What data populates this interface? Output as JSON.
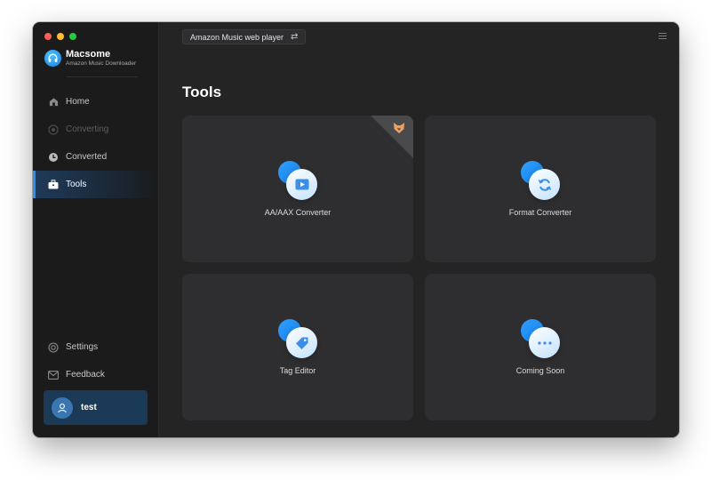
{
  "app": {
    "name": "Macsome",
    "subtitle": "Amazon Music Downloader"
  },
  "sidebar": {
    "items": [
      {
        "label": "Home",
        "icon": "home-icon",
        "state": "normal"
      },
      {
        "label": "Converting",
        "icon": "converting-icon",
        "state": "disabled"
      },
      {
        "label": "Converted",
        "icon": "clock-icon",
        "state": "normal"
      },
      {
        "label": "Tools",
        "icon": "toolbox-icon",
        "state": "active"
      }
    ],
    "bottom_items": [
      {
        "label": "Settings",
        "icon": "gear-icon"
      },
      {
        "label": "Feedback",
        "icon": "mail-icon"
      }
    ],
    "user": {
      "name": "test"
    }
  },
  "header": {
    "source_label": "Amazon Music web player",
    "source_swap_icon": "swap-icon"
  },
  "main": {
    "title": "Tools",
    "cards": [
      {
        "label": "AA/AAX Converter",
        "icon": "video-icon",
        "premium_badge": true
      },
      {
        "label": "Format Converter",
        "icon": "refresh-icon",
        "premium_badge": false
      },
      {
        "label": "Tag Editor",
        "icon": "tag-icon",
        "premium_badge": false
      },
      {
        "label": "Coming Soon",
        "icon": "ellipsis-icon",
        "premium_badge": false
      }
    ]
  },
  "colors": {
    "accent": "#2f8ef0",
    "sidebar_bg": "#1b1b1c",
    "main_bg": "#242424",
    "card_bg": "#2e2e30",
    "badge_orange": "#f0a060"
  }
}
